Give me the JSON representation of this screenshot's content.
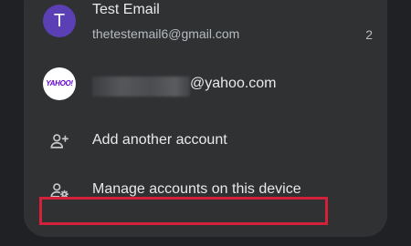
{
  "accounts": [
    {
      "avatar_letter": "T",
      "name": "Test Email",
      "email": "thetestemail6@gmail.com",
      "unread_count": "2"
    },
    {
      "avatar_logo": "YAHOO!",
      "email_suffix": "@yahoo.com"
    }
  ],
  "actions": {
    "add_account": "Add another account",
    "manage_accounts": "Manage accounts on this device"
  },
  "colors": {
    "avatar_bg": "#5b3fb5",
    "highlight": "#d4213a",
    "yahoo_purple": "#5f01d1"
  }
}
